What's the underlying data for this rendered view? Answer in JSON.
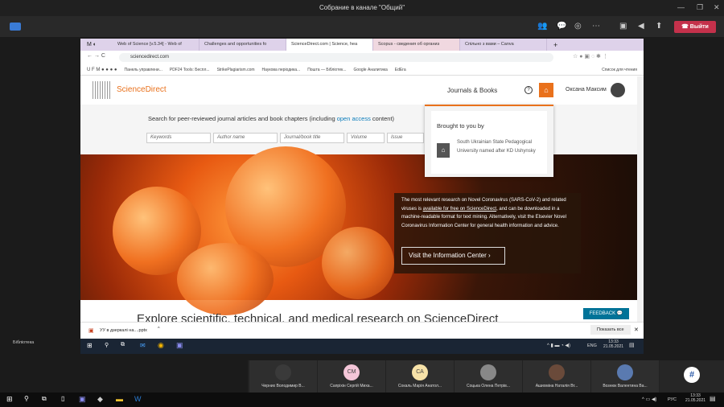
{
  "teams": {
    "title": "Собрание в канале \"Общий\"",
    "leave_label": "Выйти",
    "left_label": "Бібліотека"
  },
  "browser": {
    "tabs": [
      {
        "label": "Web of Science [v.5.34] - Web of"
      },
      {
        "label": "Challenges and opportunities fo"
      },
      {
        "label": "ScienceDirect.com | Science, hea"
      },
      {
        "label": "Scopus - сведения об организ"
      },
      {
        "label": "Спільно з вами – Canva"
      }
    ],
    "url": "sciencedirect.com",
    "bookmarks": [
      "Панель управлени...",
      "PDF24 Tools: Беспл...",
      "StrikePlagiarism.com",
      "Наукова періодика...",
      "Пошта — Бібліотек...",
      "Google Аналитика",
      "EdEra"
    ],
    "reading_list": "Список для чтения"
  },
  "page": {
    "logo": "ScienceDirect",
    "journals_books": "Journals & Books",
    "user": "Оксана Максим",
    "search_prompt": "Search for peer-reviewed journal articles and book chapters (including ",
    "open_access": "open access",
    "search_suffix": " content)",
    "fields": {
      "keywords": "Keywords",
      "author": "Author name",
      "journal": "Journal/book title",
      "volume": "Volume",
      "issue": "Issue"
    },
    "popup": {
      "title": "Brought to you by",
      "institution": "South Ukrainian State Pedagogical University named after KD Ushynsky"
    },
    "hero": {
      "text1": "The most relevant research on Novel Coronavirus (SARS-CoV-2) and related viruses is ",
      "link": "available for free on ScienceDirect",
      "text2": ", and can be downloaded in a machine-readable format for text mining. Alternatively, visit the Elsevier Novel Coronavirus Information Center for general health information and advice.",
      "button": "Visit the Information Center"
    },
    "explore": "Explore scientific, technical, and medical research on ScienceDirect",
    "feedback": "FEEDBACK"
  },
  "download": {
    "file": "УУ в дзеркалі на....pptx",
    "show_all": "Показать все"
  },
  "inner_taskbar": {
    "lang": "ENG",
    "time": "13:33",
    "date": "21.05.2021"
  },
  "participants": [
    {
      "name": "Черних Володимир В...",
      "initials": ""
    },
    {
      "name": "Сапріхін Сергій Миха...",
      "initials": "СМ",
      "color": "#f4c6d8"
    },
    {
      "name": "Сокаль Марія Анатол...",
      "initials": "СА",
      "color": "#f7e2a8"
    },
    {
      "name": "Соцька Олена Петрів...",
      "initials": ""
    },
    {
      "name": "Ашихміна Наталія Вт...",
      "initials": ""
    },
    {
      "name": "Вознюк Валентина Ва...",
      "initials": ""
    }
  ],
  "os_taskbar": {
    "lang": "РУС",
    "time": "13:33",
    "date": "21.05.2021"
  }
}
